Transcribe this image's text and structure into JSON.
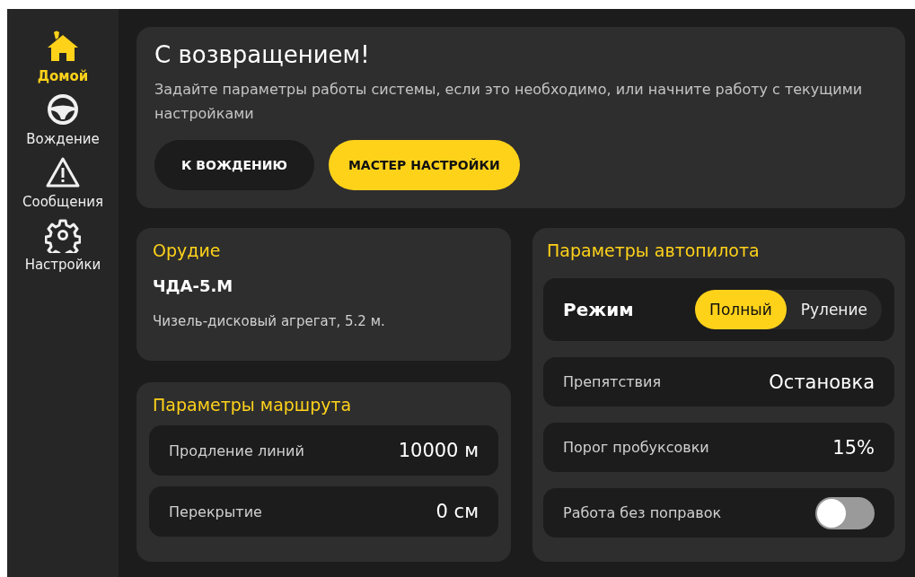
{
  "sidebar": {
    "items": [
      {
        "kind": "home",
        "label": "Домой",
        "selected": true
      },
      {
        "kind": "wheel",
        "label": "Вождение",
        "selected": false
      },
      {
        "kind": "warning",
        "label": "Сообщения",
        "selected": false
      },
      {
        "kind": "gear",
        "label": "Настройки",
        "selected": false
      }
    ]
  },
  "welcome": {
    "title": "С возвращением!",
    "text": "Задайте параметры работы системы, если это необходимо, или начните работу с текущими настройками",
    "buttons": [
      {
        "label": "К ВОЖДЕНИЮ",
        "kind": "secondary"
      },
      {
        "label": "МАСТЕР НАСТРОЙКИ",
        "kind": "primary"
      }
    ]
  },
  "implement": {
    "title": "Орудие",
    "name": "ЧДА-5.М",
    "description": "Чизель-дисковый агрегат, 5.2 м."
  },
  "route": {
    "title": "Параметры маршрута",
    "rows": [
      {
        "label": "Продление линий",
        "value": "10000 м"
      },
      {
        "label": "Перекрытие",
        "value": "0 см"
      }
    ]
  },
  "autopilot": {
    "title": "Параметры автопилота",
    "rows": [
      {
        "kind": "mode",
        "label": "Режим",
        "options": [
          {
            "label": "Полный",
            "selected": true
          },
          {
            "label": "Руление",
            "selected": false
          }
        ]
      },
      {
        "kind": "value",
        "label": "Препятствия",
        "value": "Остановка"
      },
      {
        "kind": "value",
        "label": "Порог пробуксовки",
        "value": "15%"
      },
      {
        "kind": "toggle",
        "label": "Работа без поправок",
        "on": false
      }
    ]
  }
}
